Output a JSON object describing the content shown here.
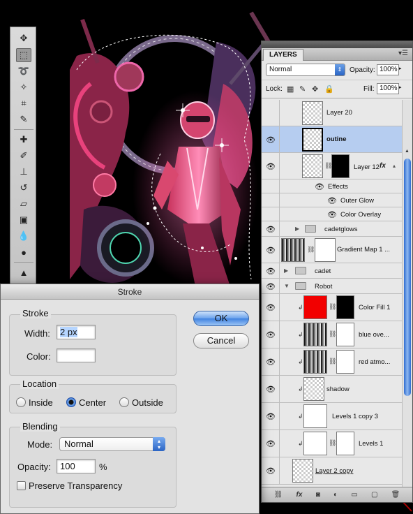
{
  "layers_panel": {
    "tab_label": "LAYERS",
    "blend_mode": "Normal",
    "opacity_label": "Opacity:",
    "opacity_value": "100%",
    "lock_label": "Lock:",
    "fill_label": "Fill:",
    "fill_value": "100%",
    "rows": [
      {
        "name": "Layer 20"
      },
      {
        "name": "outine"
      },
      {
        "name": "Layer 12"
      },
      {
        "name": "Effects"
      },
      {
        "name": "Outer Glow"
      },
      {
        "name": "Color Overlay"
      },
      {
        "name": "cadetglows"
      },
      {
        "name": "Gradient Map 1 ..."
      },
      {
        "name": "cadet"
      },
      {
        "name": "Robot"
      },
      {
        "name": "Color Fill 1"
      },
      {
        "name": "blue ove..."
      },
      {
        "name": "red atmo..."
      },
      {
        "name": "shadow"
      },
      {
        "name": "Levels 1 copy 3"
      },
      {
        "name": "Levels 1"
      },
      {
        "name": "Layer 2 copy"
      }
    ],
    "fx_label": "fx"
  },
  "stroke_dialog": {
    "title": "Stroke",
    "stroke_group": "Stroke",
    "width_label": "Width:",
    "width_value": "2 px",
    "color_label": "Color:",
    "location_group": "Location",
    "location_options": [
      "Inside",
      "Center",
      "Outside"
    ],
    "location_selected": "Center",
    "blending_group": "Blending",
    "mode_label": "Mode:",
    "mode_value": "Normal",
    "opacity_label": "Opacity:",
    "opacity_value": "100",
    "opacity_unit": "%",
    "preserve_label": "Preserve Transparency",
    "ok_label": "OK",
    "cancel_label": "Cancel"
  },
  "colors": {
    "selection_highlight": "#b6cdf0",
    "color_fill": "#f20000",
    "accent_blue": "#3f82e0"
  }
}
